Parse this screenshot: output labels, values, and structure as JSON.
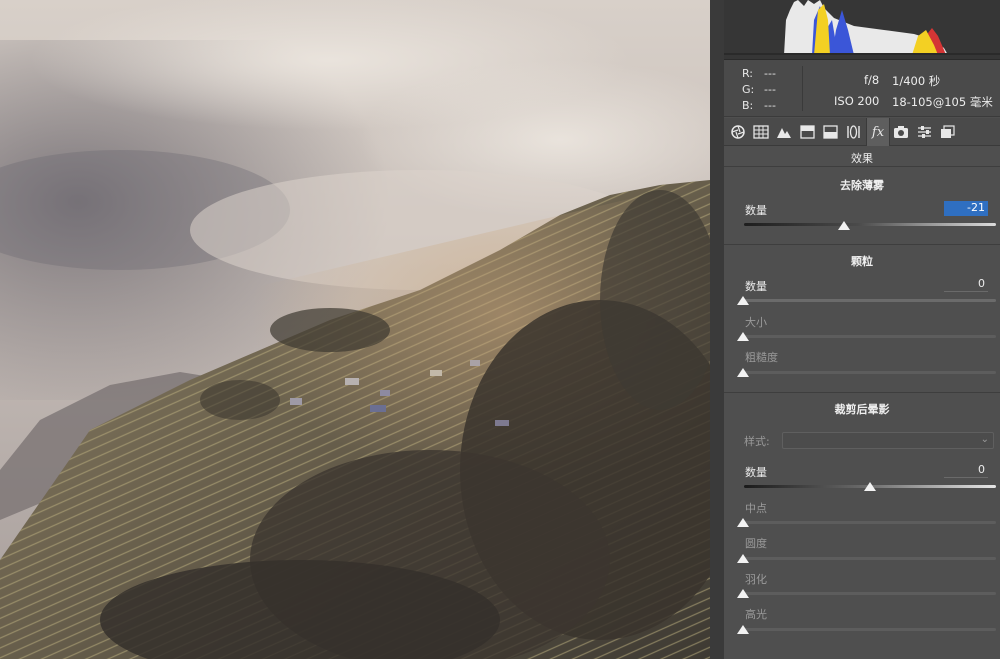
{
  "info": {
    "rgb": [
      {
        "key": "R:",
        "value": "---"
      },
      {
        "key": "G:",
        "value": "---"
      },
      {
        "key": "B:",
        "value": "---"
      }
    ],
    "aperture": "f/8",
    "shutter": "1/400 秒",
    "iso": "ISO 200",
    "lens": "18-105@105 毫米"
  },
  "tabs": {
    "icons": [
      "aperture-icon",
      "grid-icon",
      "mountain-icon",
      "split-icon",
      "hsl-icon",
      "lens-icon",
      "fx-icon",
      "camera-icon",
      "sliders-icon",
      "presets-icon"
    ],
    "fx_label": "fx",
    "active": "fx-icon"
  },
  "panel": {
    "title": "效果",
    "dehaze": {
      "title": "去除薄雾",
      "amount_label": "数量",
      "amount_value": "-21",
      "amount_fraction": 0.395
    },
    "grain": {
      "title": "颗粒",
      "amount_label": "数量",
      "amount_value": "0",
      "size_label": "大小",
      "roughness_label": "粗糙度"
    },
    "vignette": {
      "title": "裁剪后晕影",
      "style_label": "样式:",
      "amount_label": "数量",
      "amount_value": "0",
      "amount_fraction": 0.5,
      "midpoint_label": "中点",
      "roundness_label": "圆度",
      "feather_label": "羽化",
      "highlights_label": "高光"
    }
  }
}
